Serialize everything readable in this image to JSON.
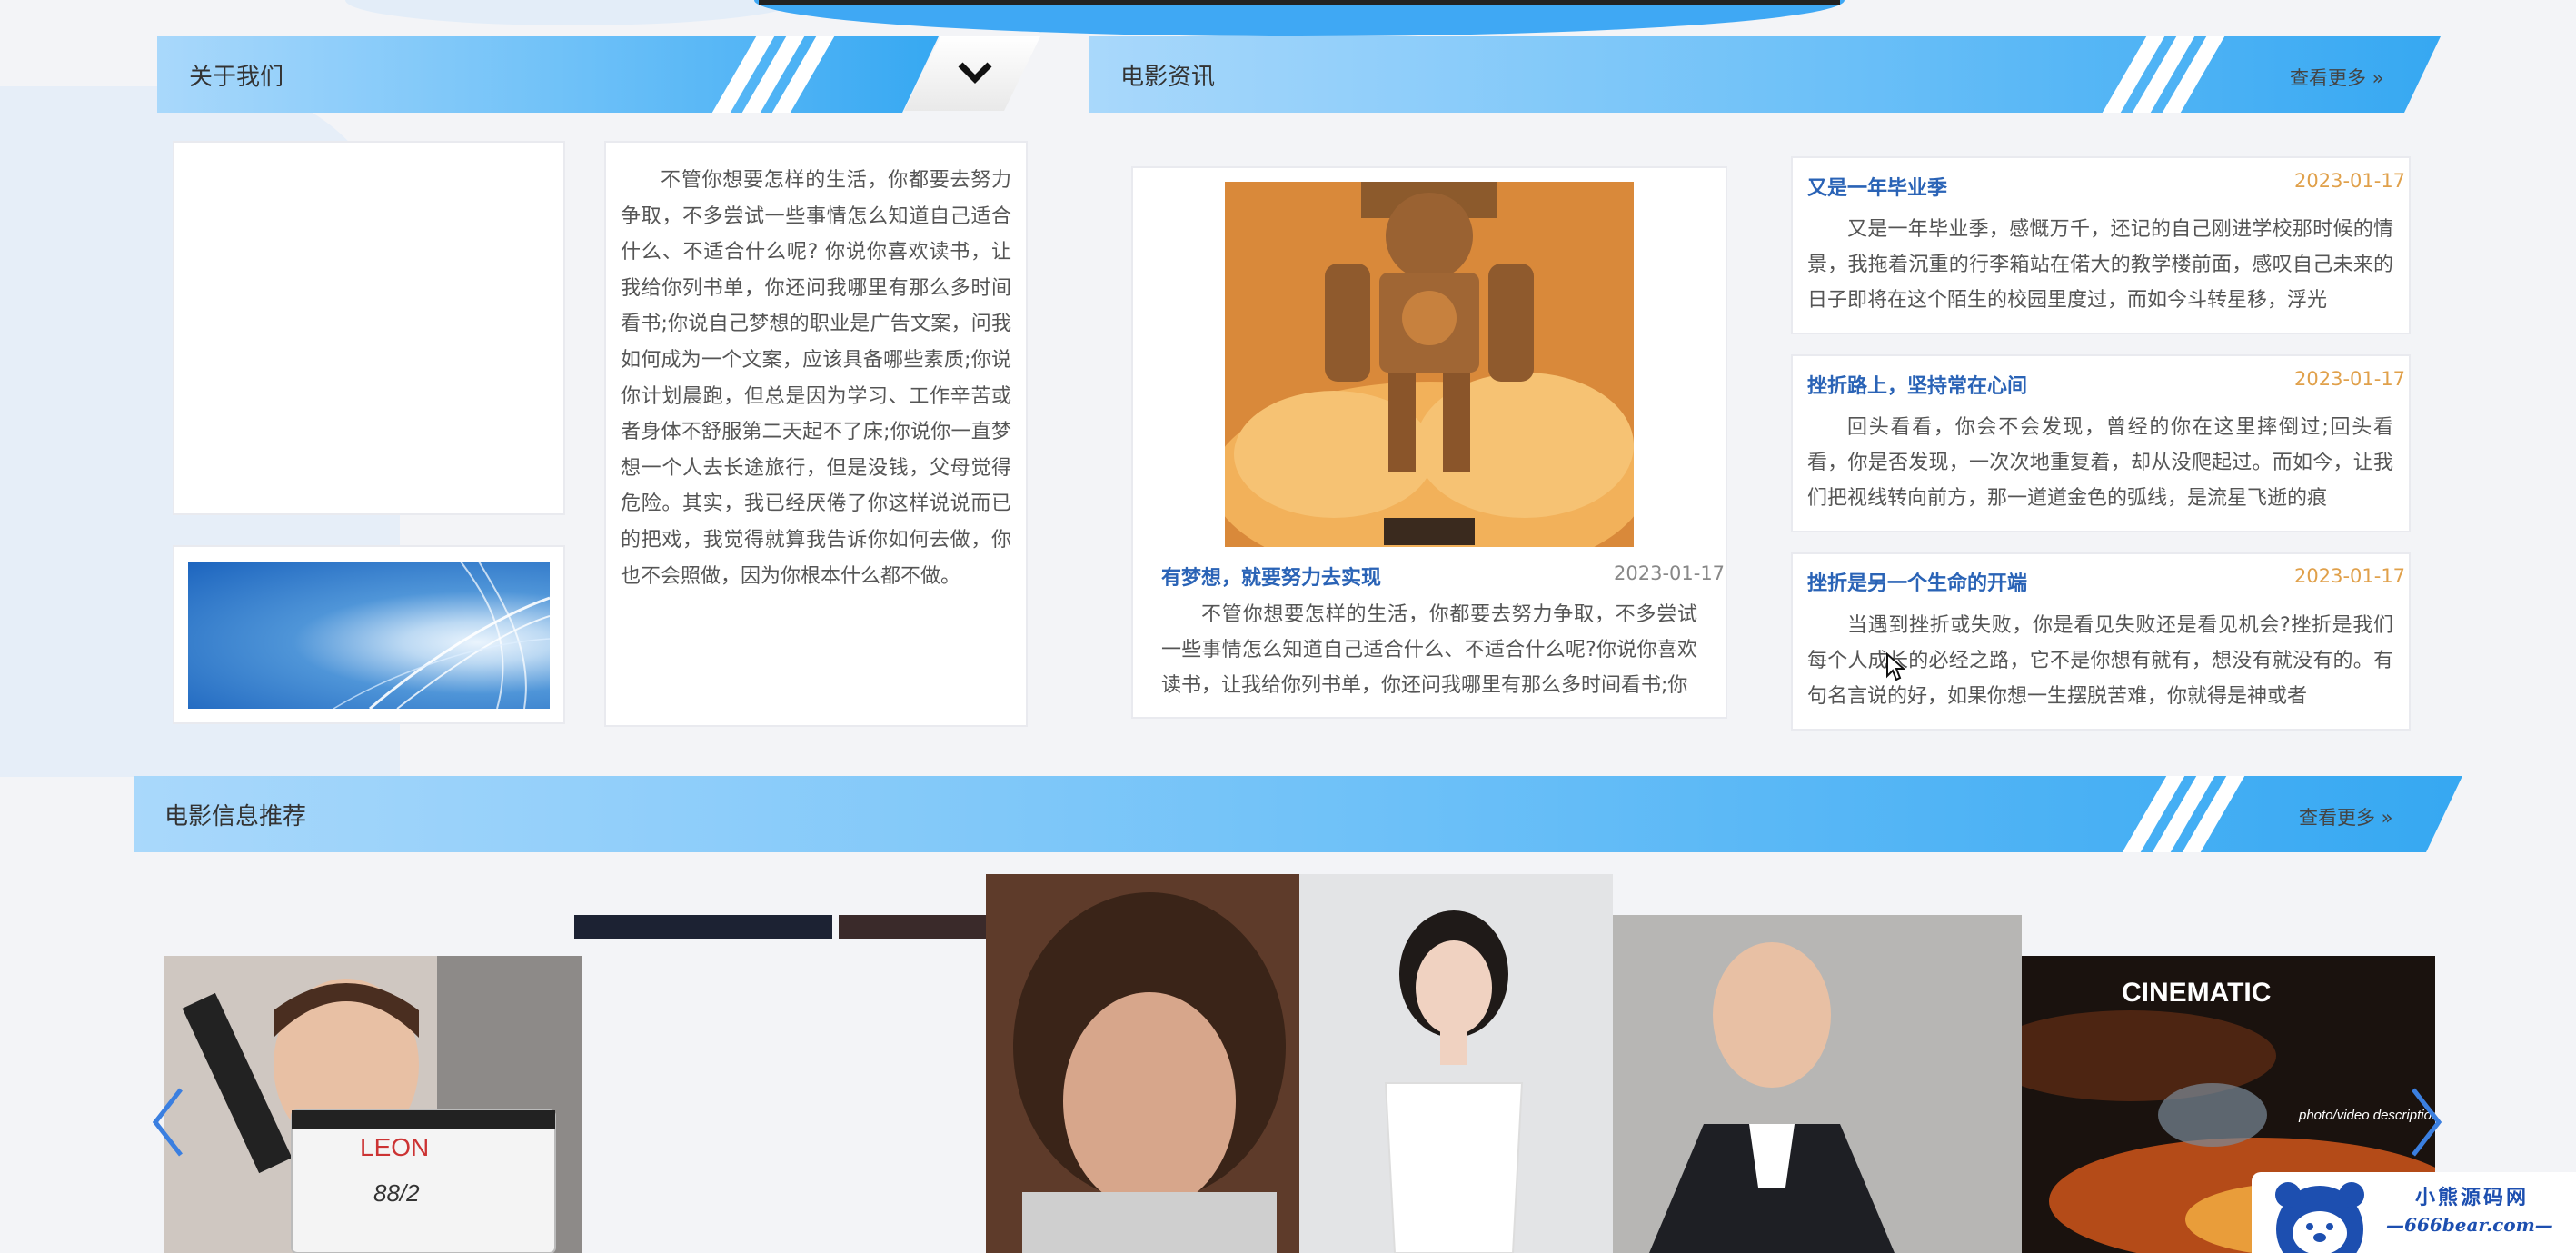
{
  "about": {
    "title": "关于我们",
    "text": "不管你想要怎样的生活，你都要去努力争取，不多尝试一些事情怎么知道自己适合什么、不适合什么呢? 你说你喜欢读书，让我给你列书单，你还问我哪里有那么多时间看书;你说自己梦想的职业是广告文案，问我如何成为一个文案，应该具备哪些素质;你说你计划晨跑，但总是因为学习、工作辛苦或者身体不舒服第二天起不了床;你说你一直梦想一个人去长途旅行，但是没钱，父母觉得危险。其实，我已经厌倦了你这样说说而已的把戏，我觉得就算我告诉你如何去做，你也不会照做，因为你根本什么都不做。"
  },
  "news": {
    "title": "电影资讯",
    "more_label": "查看更多 »",
    "featured": {
      "title": "有梦想，就要努力去实现",
      "date": "2023-01-17",
      "summary": "不管你想要怎样的生活，你都要去努力争取，不多尝试一些事情怎么知道自己适合什么、不适合什么呢?你说你喜欢读书，让我给你列书单，你还问我哪里有那么多时间看书;你"
    },
    "items": [
      {
        "title": "又是一年毕业季",
        "date": "2023-01-17",
        "summary": "又是一年毕业季，感慨万千，还记的自己刚进学校那时候的情景，我拖着沉重的行李箱站在偌大的教学楼前面，感叹自己未来的日子即将在这个陌生的校园里度过，而如今斗转星移，浮光"
      },
      {
        "title": "挫折路上，坚持常在心间",
        "date": "2023-01-17",
        "summary": "回头看看，你会不会发现，曾经的你在这里摔倒过;回头看看，你是否发现，一次次地重复着，却从没爬起过。而如今，让我们把视线转向前方，那一道道金色的弧线，是流星飞逝的痕"
      },
      {
        "title": "挫折是另一个生命的开端",
        "date": "2023-01-17",
        "summary": "当遇到挫折或失败，你是看见失败还是看见机会?挫折是我们每个人成长的必经之路，它不是你想有就有，想没有就没有的。有句名言说的好，如果你想一生摆脱苦难，你就得是神或者"
      }
    ]
  },
  "recommend": {
    "title": "电影信息推荐",
    "more_label": "查看更多 »",
    "cards": [
      {
        "label": "LEON"
      },
      {
        "label": "88/2"
      },
      {
        "label": "CINEMATIC"
      },
      {
        "label": "photo/video description"
      }
    ]
  },
  "watermark": {
    "title": "小熊源码网",
    "url": "—666bear.com—"
  },
  "icons": {
    "dropdown": "chevron-down-icon",
    "prev": "chevron-left-icon",
    "next": "chevron-right-icon"
  },
  "colors": {
    "accent": "#36a8f2",
    "news_title": "#2a63b6",
    "news_date": "#e0a04a"
  }
}
